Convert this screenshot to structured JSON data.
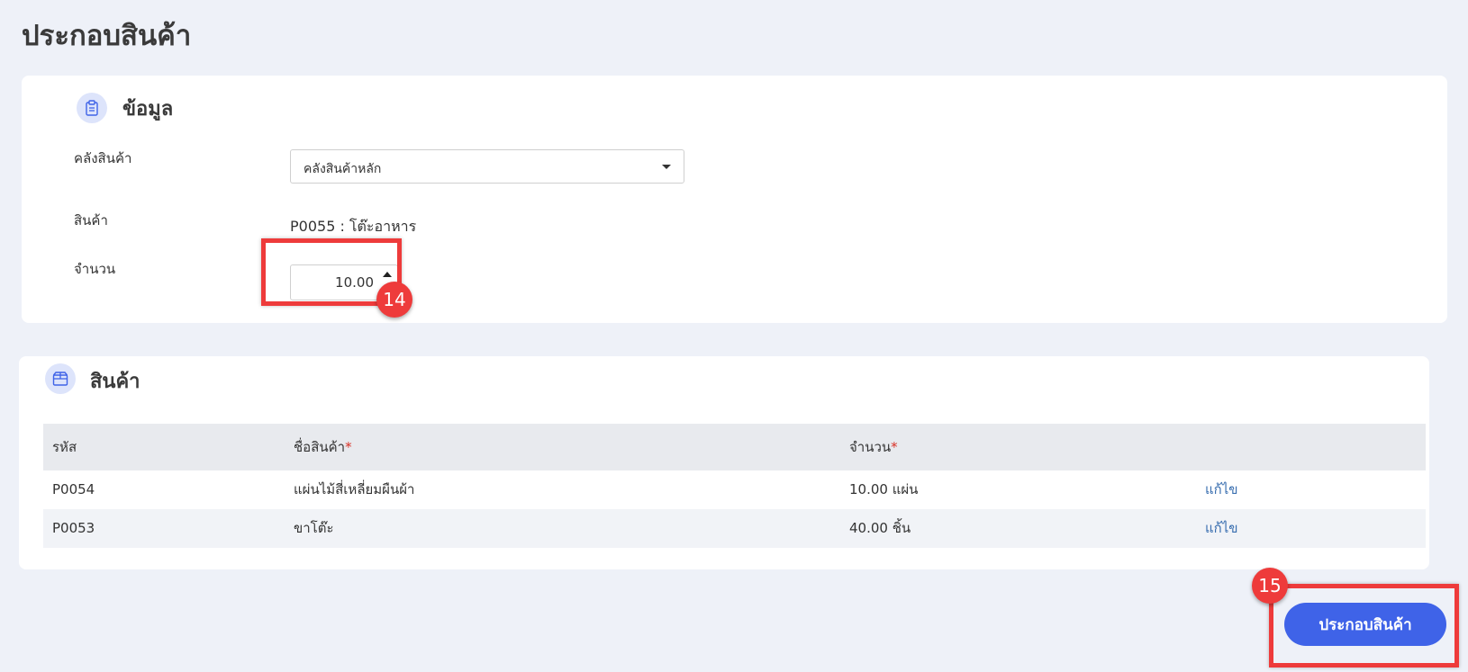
{
  "page": {
    "title": "ประกอบสินค้า"
  },
  "info_section": {
    "title": "ข้อมูล",
    "icon": "clipboard-icon",
    "warehouse_label": "คลังสินค้า",
    "warehouse_value": "คลังสินค้าหลัก",
    "product_label": "สินค้า",
    "product_value": "P0055 : โต๊ะอาหาร",
    "quantity_label": "จำนวน",
    "quantity_value": "10.00"
  },
  "products_section": {
    "title": "สินค้า",
    "icon": "box-icon",
    "columns": {
      "code": "รหัส",
      "name": "ชื่อสินค้า",
      "quantity": "จำนวน",
      "required_mark": "*"
    },
    "rows": [
      {
        "code": "P0054",
        "name": "แผ่นไม้สี่เหลี่ยมผืนผ้า",
        "quantity": "10.00 แผ่น",
        "action": "แก้ไข"
      },
      {
        "code": "P0053",
        "name": "ขาโต๊ะ",
        "quantity": "40.00 ชิ้น",
        "action": "แก้ไข"
      }
    ]
  },
  "actions": {
    "submit_label": "ประกอบสินค้า"
  },
  "annotations": {
    "step_quantity": "14",
    "step_submit": "15",
    "highlight_color": "#ee3b3b"
  },
  "colors": {
    "accent": "#3f63e8",
    "background": "#eef1f8",
    "link": "#3a6fb0"
  }
}
